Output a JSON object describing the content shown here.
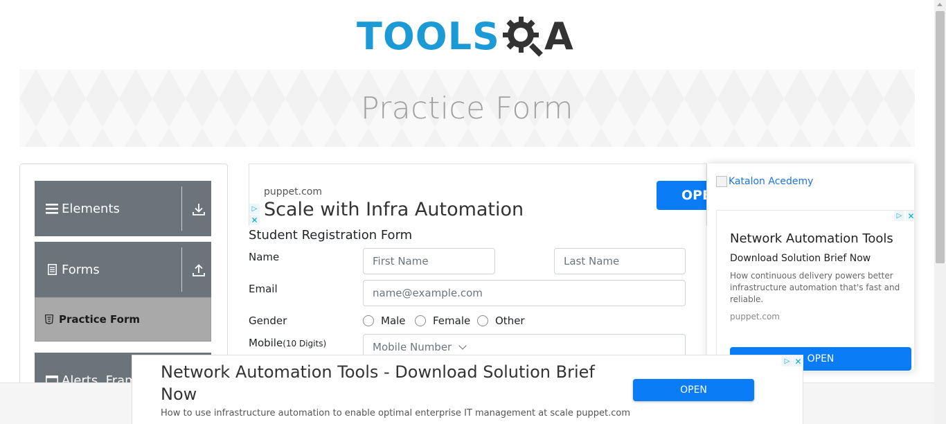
{
  "logo": {
    "text": "TOOLS",
    "suffix": "A"
  },
  "banner": {
    "title": "Practice Form"
  },
  "sidebar": {
    "groups": [
      {
        "label": "Elements",
        "icon": "hamburger-icon",
        "arrow": "download-arrow-icon"
      },
      {
        "label": "Forms",
        "icon": "document-icon",
        "arrow": "upload-arrow-icon"
      },
      {
        "label": "Alerts, Fram",
        "icon": "window-icon"
      }
    ],
    "active_item": {
      "label": "Practice Form",
      "icon": "html5-shield-icon"
    }
  },
  "top_ad": {
    "domain": "puppet.com",
    "headline": "Scale with Infra Automation",
    "open_label": "OPE"
  },
  "form": {
    "title": "Student Registration Form",
    "name_label": "Name",
    "first_name_placeholder": "First Name",
    "last_name_placeholder": "Last Name",
    "email_label": "Email",
    "email_placeholder": "name@example.com",
    "gender_label": "Gender",
    "gender_options": [
      "Male",
      "Female",
      "Other"
    ],
    "mobile_label": "Mobile",
    "mobile_hint": "(10 Digits)",
    "mobile_placeholder": "Mobile Number"
  },
  "right_ad": {
    "image_alt": "Katalon Acedemy",
    "title": "Network Automation Tools",
    "subtitle": "Download Solution Brief Now",
    "description": "How continuous delivery powers better infrastructure automation that's fast and reliable.",
    "domain": "puppet.com",
    "open_label": "OPEN"
  },
  "bottom_ad": {
    "headline": "Network Automation Tools - Download Solution Brief Now",
    "description": "How to use infrastructure automation to enable optimal enterprise IT management at scale puppet.com",
    "open_label": "OPEN"
  },
  "colors": {
    "brand_blue": "#1b9ad6",
    "sidebar_group": "#6b737b",
    "active_item": "#a9a9a9",
    "ad_button": "#0a7cf6"
  }
}
